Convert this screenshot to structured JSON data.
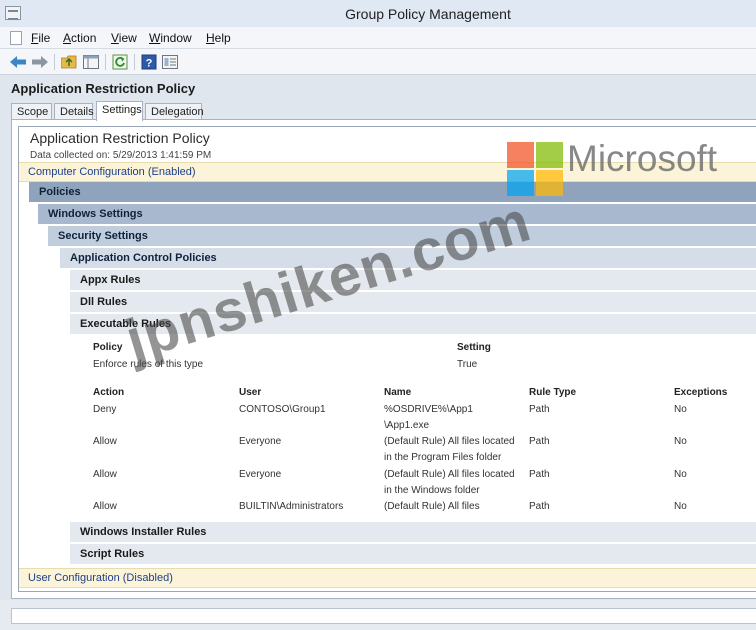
{
  "window": {
    "title": "Group Policy Management"
  },
  "menu": [
    "File",
    "Action",
    "View",
    "Window",
    "Help"
  ],
  "toolbar": {
    "buttons": [
      "back-arrow-icon",
      "forward-arrow-icon",
      "folder-up-icon",
      "show-hide-tree-icon",
      "refresh-icon",
      "help-icon",
      "properties-icon"
    ],
    "back_color": "#3a86c8",
    "forward_color": "#8c96a2"
  },
  "page": {
    "heading": "Application Restriction Policy",
    "tabs": [
      {
        "label": "Scope",
        "active": false
      },
      {
        "label": "Details",
        "active": false
      },
      {
        "label": "Settings",
        "active": true
      },
      {
        "label": "Delegation",
        "active": false
      }
    ]
  },
  "report": {
    "title": "Application Restriction Policy",
    "collected": "Data collected on: 5/29/2013 1:41:59 PM",
    "computer_config": "Computer Configuration (Enabled)",
    "user_config": "User Configuration (Disabled)",
    "sections": {
      "policies": "Policies",
      "windows_settings": "Windows Settings",
      "security_settings": "Security Settings",
      "app_control": "Application Control Policies",
      "appx": "Appx Rules",
      "dll": "Dll Rules",
      "exe": "Executable Rules",
      "installer": "Windows Installer Rules",
      "script": "Script Rules"
    },
    "enforce_table": {
      "headers": [
        "Policy",
        "Setting"
      ],
      "rows": [
        [
          "Enforce rules of this type",
          "True"
        ]
      ]
    },
    "rules_table": {
      "headers": [
        "Action",
        "User",
        "Name",
        "Rule Type",
        "Exceptions"
      ],
      "rows": [
        {
          "action": "Deny",
          "user": "CONTOSO\\Group1",
          "name1": "%OSDRIVE%\\App1",
          "name2": "\\App1.exe",
          "type": "Path",
          "exceptions": "No"
        },
        {
          "action": "Allow",
          "user": "Everyone",
          "name1": "(Default Rule) All files located",
          "name2": "in the Program Files folder",
          "type": "Path",
          "exceptions": "No"
        },
        {
          "action": "Allow",
          "user": "Everyone",
          "name1": "(Default Rule) All files located",
          "name2": "in the Windows folder",
          "type": "Path",
          "exceptions": "No"
        },
        {
          "action": "Allow",
          "user": "BUILTIN\\Administrators",
          "name1": "(Default Rule) All files",
          "name2": "",
          "type": "Path",
          "exceptions": "No"
        }
      ]
    }
  },
  "overlay": {
    "brand": "Microsoft",
    "brand_colors": [
      "#f25022",
      "#7fba00",
      "#00a4ef",
      "#ffb900"
    ],
    "watermark": "jpnshiken.com"
  },
  "colors": {
    "band_policies": "#8fa3bd",
    "band_windows": "#a8b9cf",
    "band_security": "#bfcddd",
    "band_app_control": "#d4dde8",
    "band_rules": "#e4e9ef",
    "config_bg": "#fcf4d9",
    "config_text": "#1e3f8a"
  }
}
